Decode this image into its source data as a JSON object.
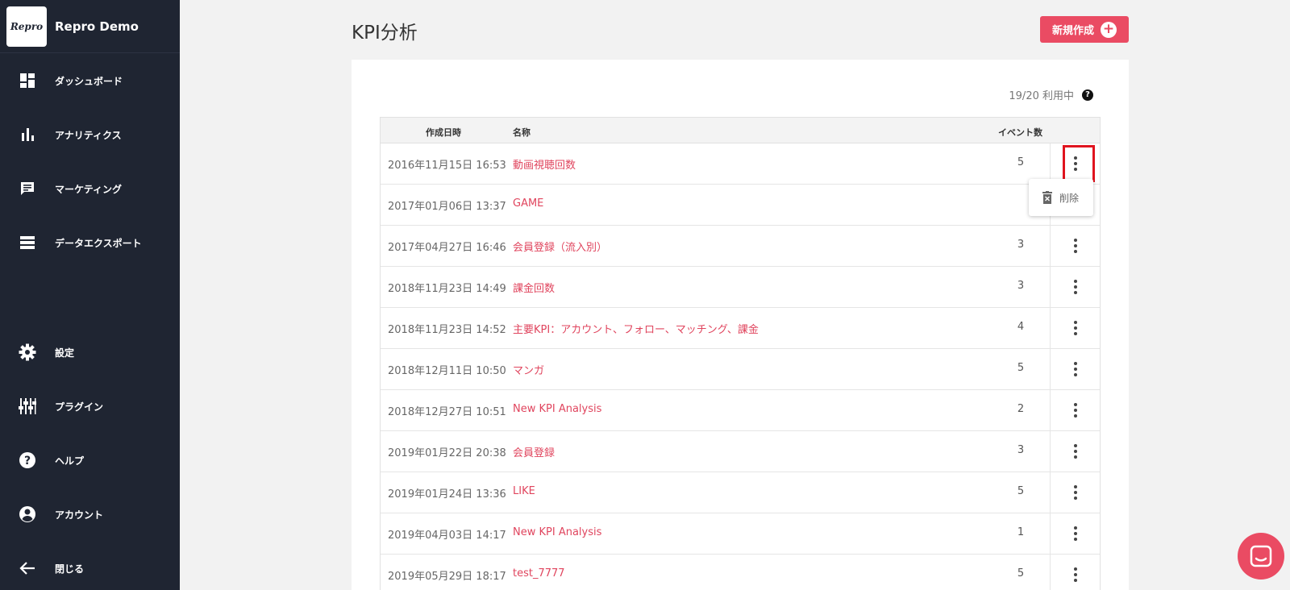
{
  "sidebar": {
    "logo_text": "Repro",
    "app_name": "Repro Demo",
    "items": [
      {
        "label": "ダッシュボード",
        "icon": "dashboard-icon"
      },
      {
        "label": "アナリティクス",
        "icon": "bar-chart-icon"
      },
      {
        "label": "マーケティング",
        "icon": "message-icon"
      },
      {
        "label": "データエクスポート",
        "icon": "storage-icon"
      }
    ],
    "bottom_items": [
      {
        "label": "設定",
        "icon": "gear-icon"
      },
      {
        "label": "プラグイン",
        "icon": "plugin-icon"
      },
      {
        "label": "ヘルプ",
        "icon": "help-icon"
      },
      {
        "label": "アカウント",
        "icon": "account-icon"
      },
      {
        "label": "閉じる",
        "icon": "arrow-left-icon"
      }
    ]
  },
  "header": {
    "title": "KPI分析",
    "new_button_label": "新規作成"
  },
  "usage_text": "19/20 利用中",
  "table": {
    "headers": {
      "date": "作成日時",
      "name": "名称",
      "events": "イベント数"
    },
    "rows": [
      {
        "date": "2016年11月15日 16:53",
        "name": "動画視聴回数",
        "events": "5"
      },
      {
        "date": "2017年01月06日 13:37",
        "name": "GAME",
        "events": ""
      },
      {
        "date": "2017年04月27日 16:46",
        "name": "会員登録（流入別）",
        "events": "3"
      },
      {
        "date": "2018年11月23日 14:49",
        "name": "課金回数",
        "events": "3"
      },
      {
        "date": "2018年11月23日 14:52",
        "name": "主要KPI：アカウント、フォロー、マッチング、課金",
        "events": "4"
      },
      {
        "date": "2018年12月11日 10:50",
        "name": "マンガ",
        "events": "5"
      },
      {
        "date": "2018年12月27日 10:51",
        "name": "New KPI Analysis",
        "events": "2"
      },
      {
        "date": "2019年01月22日 20:38",
        "name": "会員登録",
        "events": "3"
      },
      {
        "date": "2019年01月24日 13:36",
        "name": "LIKE",
        "events": "5"
      },
      {
        "date": "2019年04月03日 14:17",
        "name": "New KPI Analysis",
        "events": "1"
      },
      {
        "date": "2019年05月29日 18:17",
        "name": "test_7777",
        "events": "5"
      }
    ]
  },
  "dropdown": {
    "delete_label": "削除"
  },
  "colors": {
    "accent": "#ea4b63",
    "sidebar_bg": "#1f2532",
    "link": "#e0455e",
    "highlight": "#e0141e"
  }
}
